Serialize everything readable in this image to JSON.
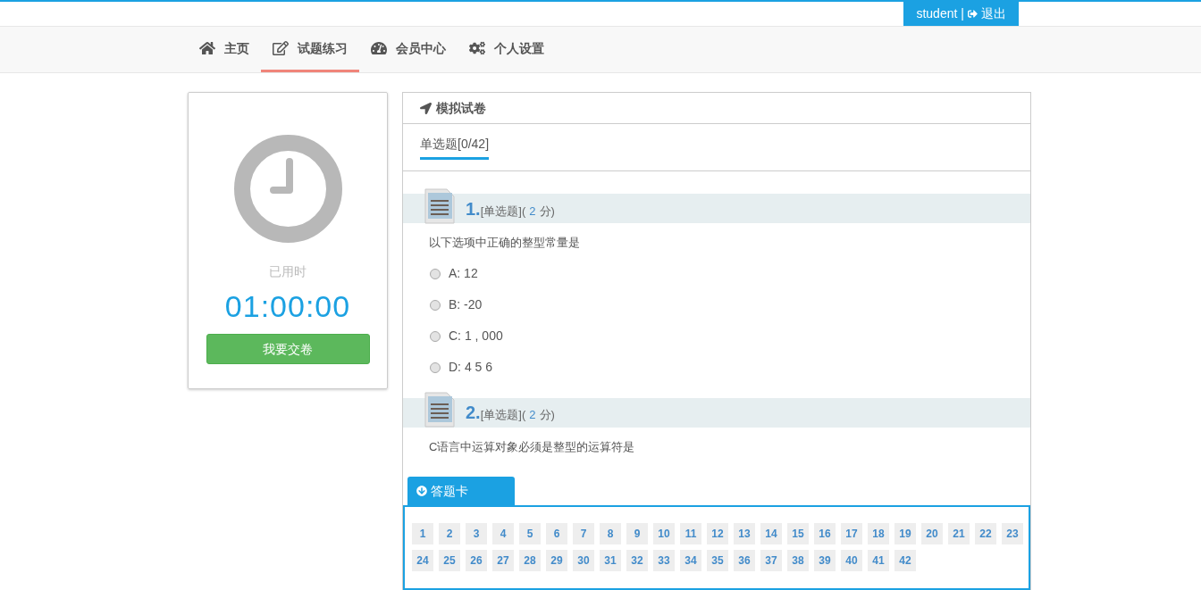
{
  "user_button": {
    "username": "student",
    "separator": "|",
    "logout": "退出"
  },
  "nav": [
    {
      "label": "主页",
      "selected": false
    },
    {
      "label": "试题练习",
      "selected": true
    },
    {
      "label": "会员中心",
      "selected": false
    },
    {
      "label": "个人设置",
      "selected": false
    }
  ],
  "timer_card": {
    "label": "已用时",
    "time": "01:00:00",
    "submit_button": "我要交卷"
  },
  "exam": {
    "title": "模拟试卷",
    "tabs": [
      {
        "label": "单选题[0/42]",
        "selected": true
      }
    ],
    "questions": [
      {
        "number": "1.",
        "type": "[单选题]",
        "score_open": "(",
        "score": "2",
        "score_unit": "分)",
        "text": "以下选项中正确的整型常量是",
        "options": [
          {
            "label": "A: 12",
            "selected": false
          },
          {
            "label": "B: -20",
            "selected": false
          },
          {
            "label": "C: 1 , 000",
            "selected": false
          },
          {
            "label": "D: 4 5 6",
            "selected": false
          }
        ]
      },
      {
        "number": "2.",
        "type": "[单选题]",
        "score_open": "(",
        "score": "2",
        "score_unit": "分)",
        "text": "C语言中运算对象必须是整型的运算符是"
      }
    ]
  },
  "answer_card": {
    "title": "答题卡",
    "numbers": [
      "1",
      "2",
      "3",
      "4",
      "5",
      "6",
      "7",
      "8",
      "9",
      "10",
      "11",
      "12",
      "13",
      "14",
      "15",
      "16",
      "17",
      "18",
      "19",
      "20",
      "21",
      "22",
      "23",
      "24",
      "25",
      "26",
      "27",
      "28",
      "29",
      "30",
      "31",
      "32",
      "33",
      "34",
      "35",
      "36",
      "37",
      "38",
      "39",
      "40",
      "41",
      "42"
    ]
  }
}
